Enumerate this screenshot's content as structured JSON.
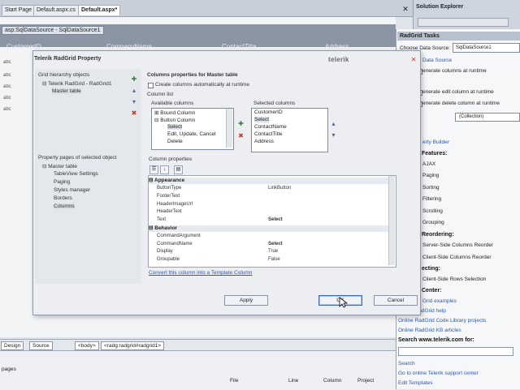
{
  "ide": {
    "doc_tabs": [
      "Start Page",
      "Default.aspx.cs",
      "Default.aspx*"
    ],
    "close_icon": "close-icon",
    "datasource_tag": "asp:SqlDataSource - SqlDataSource1",
    "grid_columns": [
      "CustomerID",
      "CompanyName",
      "ContactTitle",
      "Address"
    ],
    "abc_rows": [
      "abc",
      "abc",
      "abc",
      "abc",
      "abc"
    ],
    "bottom_tabs": [
      "Design",
      "Source",
      "<body>",
      "<radg:radgrid#radgrid1>"
    ],
    "error_list_title": "pages",
    "error_list_columns": [
      "File",
      "Line",
      "Column",
      "Project"
    ]
  },
  "solution_explorer": {
    "title": "Solution Explorer"
  },
  "tasks": {
    "title": "RadGrid Tasks",
    "datasource_label": "Choose Data Source:",
    "datasource_value": "SqlDataSource1",
    "items": [
      {
        "text": "Data Source",
        "link": true
      },
      {
        "text": "enerate columns at runtime",
        "link": false
      },
      {
        "text": "enerate edit column at runtime",
        "link": false
      },
      {
        "text": "enerate delete column at runtime",
        "link": false
      }
    ],
    "collection": "(Collection)",
    "property_builder": "erty Builder",
    "features_head": "Features:",
    "features": [
      "AJAX",
      "Paging",
      "Sorting",
      "Filtering",
      "Scrolling",
      "Grouping"
    ],
    "reordering_head": "Reordering:",
    "reordering": [
      "Server-Side Columns Reorder",
      "Client-Side Columns Reorder"
    ],
    "selecting_head": "ecting:",
    "selecting": [
      "Client-Side Rows Selection"
    ],
    "center_head": "Center:",
    "center_links": [
      "Grid examples",
      "Online RadGrid help",
      "Online RadGrid Code Library projects",
      "Online RadGrid KB articles"
    ],
    "search_head": "Search www.telerik.com for:",
    "search_links": [
      "Search",
      "Go to online Telerik support center",
      "Edit Templates"
    ]
  },
  "dialog": {
    "title": "Telerik RadGrid Property",
    "logo": "telerik",
    "hierarchy_label": "Grid hierarchy objects",
    "hierarchy_items": [
      "Telerik RadGrid - RadGrid1",
      "Master table"
    ],
    "pages_label": "Property pages of selected object",
    "pages_items": [
      "Master table",
      "TableView Settings",
      "Paging",
      "Styles manager",
      "Borders",
      "Columns"
    ],
    "columns_header": "Columns properties for Master table",
    "auto_generate_label": "Create columns automatically at runtime",
    "column_list_label": "Column list",
    "available_label": "Available columns",
    "available_items": [
      "Bound Column",
      "Button Column",
      "Select",
      "Edit, Update, Cancel",
      "Delete"
    ],
    "selected_label": "Selected columns",
    "selected_items": [
      "CustomerID",
      "Select",
      "ContactName",
      "ContactTitle",
      "Address"
    ],
    "col_props_label": "Column properties",
    "prop_groups": [
      {
        "name": "Appearance",
        "rows": [
          {
            "n": "ButtonType",
            "v": "LinkButton",
            "bold": false
          },
          {
            "n": "FooterText",
            "v": "",
            "bold": false
          },
          {
            "n": "HeaderImageUrl",
            "v": "",
            "bold": false
          },
          {
            "n": "HeaderText",
            "v": "",
            "bold": false
          },
          {
            "n": "Text",
            "v": "Select",
            "bold": true
          }
        ]
      },
      {
        "name": "Behavior",
        "rows": [
          {
            "n": "CommandArgument",
            "v": "",
            "bold": false
          },
          {
            "n": "CommandName",
            "v": "Select",
            "bold": true
          },
          {
            "n": "Display",
            "v": "True",
            "bold": false
          },
          {
            "n": "Groupable",
            "v": "False",
            "bold": false
          }
        ]
      }
    ],
    "convert_link": "Convert this column into a Template Column",
    "buttons": {
      "apply": "Apply",
      "ok": "OK",
      "cancel": "Cancel"
    }
  }
}
